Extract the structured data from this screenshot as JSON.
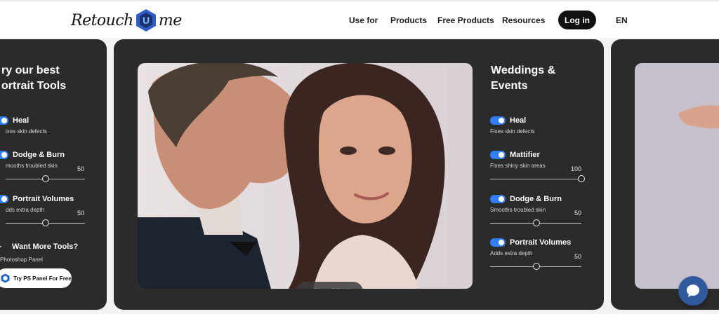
{
  "header": {
    "logo": {
      "left": "Retouch",
      "right": "me",
      "mark_letter": "U"
    },
    "nav": [
      "Use for",
      "Products",
      "Free Products",
      "Resources"
    ],
    "login_label": "Log in",
    "language": "EN"
  },
  "left_panel": {
    "title_line1": "ry our best",
    "title_line2": "ortrait Tools",
    "tools": [
      {
        "name": "Heal",
        "desc": "ixes skin defects"
      },
      {
        "name": "Dodge & Burn",
        "desc": "mooths troubled skin",
        "value": "50",
        "level": 0.5
      },
      {
        "name": "Portrait Volumes",
        "desc": "dds extra depth",
        "value": "50",
        "level": 0.5
      }
    ],
    "more_title": "Want More Tools?",
    "more_desc": "Photoshop Panel",
    "cta_label": "Try PS Panel For Free"
  },
  "main_panel": {
    "view_original": "View original",
    "title_line1": "Weddings &",
    "title_line2": "Events",
    "tools": [
      {
        "name": "Heal",
        "desc": "Fixes skin defects"
      },
      {
        "name": "Mattifier",
        "desc": "Fixes shiny skin areas",
        "value": "100",
        "level": 1.0
      },
      {
        "name": "Dodge & Burn",
        "desc": "Smooths troubled skin",
        "value": "50",
        "level": 0.5
      },
      {
        "name": "Portrait Volumes",
        "desc": "Adds extra depth",
        "value": "50",
        "level": 0.5
      }
    ]
  },
  "colors": {
    "accent": "#2f7fff",
    "panel": "#2b2b2b",
    "logo_mark": "#2d5fc7"
  },
  "icons": {
    "chat": "chat-bubble-icon",
    "photoshop": "ps-hexagon-icon",
    "sparkle": "sparkle-icon"
  }
}
